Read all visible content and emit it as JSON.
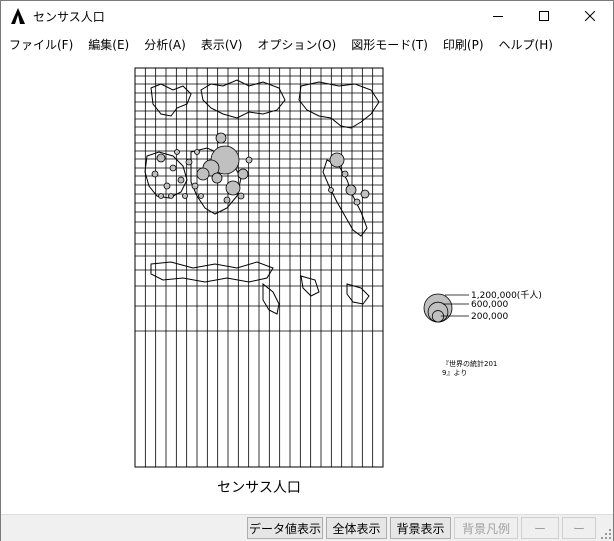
{
  "window": {
    "title": "センサス人口"
  },
  "menu": {
    "items": [
      {
        "label": "ファイル(F)"
      },
      {
        "label": "編集(E)"
      },
      {
        "label": "分析(A)"
      },
      {
        "label": "表示(V)"
      },
      {
        "label": "オプション(O)"
      },
      {
        "label": "図形モード(T)"
      },
      {
        "label": "印刷(P)"
      },
      {
        "label": "ヘルプ(H)"
      }
    ]
  },
  "map": {
    "title": "センサス人口",
    "legend": {
      "labels": [
        "1,200,000(千人)",
        "600,000",
        "200,000"
      ],
      "values": [
        1200000,
        600000,
        200000
      ]
    },
    "source_note": [
      "『世界の統計201",
      "9』より"
    ],
    "colors": {
      "symbol_fill": "#c0c0c0",
      "grid": "#000000"
    }
  },
  "status_buttons": [
    {
      "label": "データ値表示",
      "enabled": true
    },
    {
      "label": "全体表示",
      "enabled": true
    },
    {
      "label": "背景表示",
      "enabled": true
    },
    {
      "label": "背景凡例",
      "enabled": false
    },
    {
      "label": "ー",
      "enabled": false
    },
    {
      "label": "ー",
      "enabled": false
    }
  ],
  "icons": {
    "app": "app-logo-icon",
    "minimize": "minimize-icon",
    "maximize": "maximize-icon",
    "close": "close-icon"
  }
}
